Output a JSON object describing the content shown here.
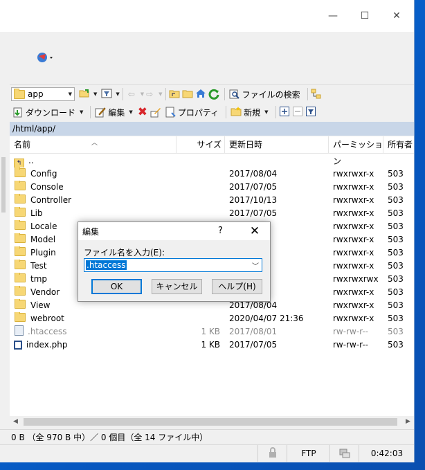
{
  "window": {
    "minimize": "—",
    "maximize": "☐",
    "close": "✕"
  },
  "toolbar": {
    "drive_combo": "app",
    "find_files": "ファイルの検索",
    "download": "ダウンロード",
    "edit": "編集",
    "properties": "プロパティ",
    "new": "新規"
  },
  "path": "/html/app/",
  "columns": {
    "name": "名前",
    "size": "サイズ",
    "modified": "更新日時",
    "permissions": "パーミッション",
    "owner": "所有者"
  },
  "files": [
    {
      "name": "..",
      "size": "",
      "modified": "",
      "permissions": "",
      "owner": "",
      "type": "up"
    },
    {
      "name": "Config",
      "size": "",
      "modified": "2017/08/04",
      "permissions": "rwxrwxr-x",
      "owner": "503",
      "type": "folder"
    },
    {
      "name": "Console",
      "size": "",
      "modified": "2017/07/05",
      "permissions": "rwxrwxr-x",
      "owner": "503",
      "type": "folder"
    },
    {
      "name": "Controller",
      "size": "",
      "modified": "2017/10/13",
      "permissions": "rwxrwxr-x",
      "owner": "503",
      "type": "folder"
    },
    {
      "name": "Lib",
      "size": "",
      "modified": "2017/07/05",
      "permissions": "rwxrwxr-x",
      "owner": "503",
      "type": "folder"
    },
    {
      "name": "Locale",
      "size": "",
      "modified": "",
      "permissions": "rwxrwxr-x",
      "owner": "503",
      "type": "folder"
    },
    {
      "name": "Model",
      "size": "",
      "modified": "",
      "permissions": "rwxrwxr-x",
      "owner": "503",
      "type": "folder"
    },
    {
      "name": "Plugin",
      "size": "",
      "modified": "",
      "permissions": "rwxrwxr-x",
      "owner": "503",
      "type": "folder"
    },
    {
      "name": "Test",
      "size": "",
      "modified": "",
      "permissions": "rwxrwxr-x",
      "owner": "503",
      "type": "folder"
    },
    {
      "name": "tmp",
      "size": "",
      "modified": "",
      "permissions": "rwxrwxrwx",
      "owner": "503",
      "type": "folder"
    },
    {
      "name": "Vendor",
      "size": "",
      "modified": "",
      "permissions": "rwxrwxr-x",
      "owner": "503",
      "type": "folder"
    },
    {
      "name": "View",
      "size": "",
      "modified": "2017/08/04",
      "permissions": "rwxrwxr-x",
      "owner": "503",
      "type": "folder"
    },
    {
      "name": "webroot",
      "size": "",
      "modified": "2020/04/07 21:36",
      "permissions": "rwxrwxr-x",
      "owner": "503",
      "type": "folder"
    },
    {
      "name": ".htaccess",
      "size": "1 KB",
      "modified": "2017/08/01",
      "permissions": "rw-rw-r--",
      "owner": "503",
      "type": "file",
      "muted": true
    },
    {
      "name": "index.php",
      "size": "1 KB",
      "modified": "2017/07/05",
      "permissions": "rw-rw-r--",
      "owner": "503",
      "type": "php"
    }
  ],
  "status": {
    "summary": "0 B （全 970 B 中）／ 0 個目（全 14 ファイル中）",
    "protocol": "FTP",
    "time": "0:42:03"
  },
  "dialog": {
    "title": "編集",
    "help_glyph": "?",
    "close_glyph": "✕",
    "label": "ファイル名を入力(E):",
    "value": ".htaccess",
    "ok": "OK",
    "cancel": "キャンセル",
    "help": "ヘルプ(H)"
  },
  "colors": {
    "selection": "#0078d7",
    "pathbar": "#c8d6e8",
    "desktop": "#0a6fd6"
  }
}
